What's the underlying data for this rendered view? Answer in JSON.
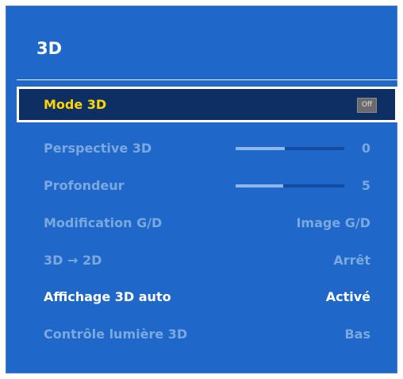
{
  "title": "3D",
  "menu": [
    {
      "label": "Mode 3D",
      "value": "Off",
      "state": "selected",
      "type": "badge"
    },
    {
      "label": "Perspective 3D",
      "value": "0",
      "state": "disabled",
      "type": "slider",
      "fill": 0.45
    },
    {
      "label": "Profondeur",
      "value": "5",
      "state": "disabled",
      "type": "slider",
      "fill": 0.44
    },
    {
      "label": "Modification G/D",
      "value": "Image G/D",
      "state": "disabled",
      "type": "text"
    },
    {
      "label": "3D → 2D",
      "value": "Arrêt",
      "state": "disabled",
      "type": "text"
    },
    {
      "label": "Affichage 3D auto",
      "value": "Activé",
      "state": "normal",
      "type": "text"
    },
    {
      "label": "Contrôle lumière 3D",
      "value": "Bas",
      "state": "disabled",
      "type": "text"
    }
  ],
  "colors": {
    "panel": "#1f68c9",
    "selected_bg": "#0d2f63",
    "selected_text": "#ffd400",
    "disabled_text": "#7aa8df"
  }
}
